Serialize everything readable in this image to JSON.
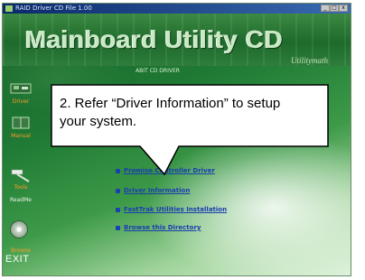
{
  "window": {
    "title": "RAID Driver CD File 1.00",
    "controls": [
      "_",
      "□",
      "x"
    ]
  },
  "header": {
    "title": "Mainboard Utility CD",
    "decor_subtitle": "Utilitymath",
    "panel_subtitle": "ABIT CD DRIVER"
  },
  "sidebar": {
    "items": [
      {
        "label": "Driver",
        "icon": "board-icon"
      },
      {
        "label": "Manual",
        "icon": "book-icon"
      },
      {
        "label": "Tools",
        "icon": "hammer-icon"
      },
      {
        "label": "ReadMe",
        "icon": "readme-icon"
      },
      {
        "label": "Browse",
        "icon": "disc-icon"
      }
    ],
    "exit_label": "EXIT"
  },
  "links": [
    "Promise Controller Driver",
    "Driver Information",
    "FastTrak Utilities Installation",
    "Browse this Directory"
  ],
  "callout": {
    "text": "2. Refer “Driver Information” to setup your system."
  },
  "colors": {
    "background_green": "#1f7a34",
    "link_blue": "#1a3fb0",
    "sidebar_label": "#ff9a2a",
    "callout_bg": "#ffffff"
  }
}
